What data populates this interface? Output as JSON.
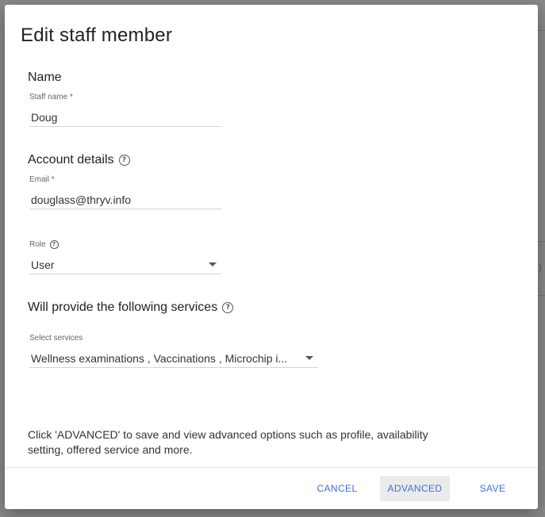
{
  "background": {
    "peek_text": ")"
  },
  "dialog": {
    "title": "Edit staff member",
    "sections": {
      "name": {
        "title": "Name"
      },
      "account": {
        "title": "Account details",
        "help_icon": "help-circle-icon"
      },
      "services": {
        "title": "Will provide the following services",
        "help_icon": "help-circle-icon"
      }
    },
    "fields": {
      "staff_name": {
        "label": "Staff name *",
        "value": "Doug"
      },
      "email": {
        "label": "Email *",
        "value": "douglass@thryv.info"
      },
      "role": {
        "label": "Role",
        "value": "User",
        "help_icon": "help-circle-icon"
      },
      "services": {
        "label": "Select services",
        "value": "Wellness examinations , Vaccinations , Microchip i..."
      }
    },
    "info_text": "Click 'ADVANCED' to save and view advanced options such as profile, availability setting, offered service and more.",
    "buttons": {
      "cancel": "CANCEL",
      "advanced": "ADVANCED",
      "save": "SAVE"
    }
  },
  "colors": {
    "accent": "#3a6fd8",
    "overlay": "#8a8a8a",
    "advanced_bg": "#ebebeb"
  }
}
